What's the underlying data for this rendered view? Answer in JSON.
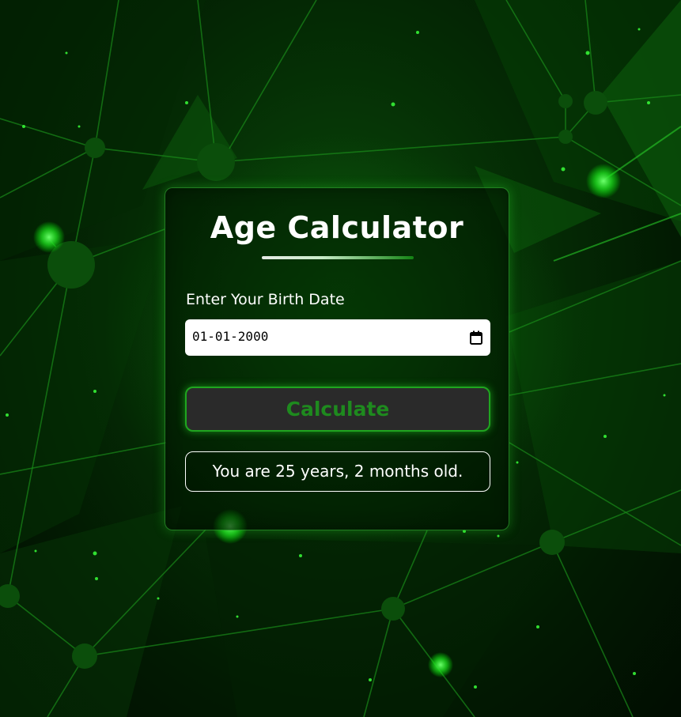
{
  "app": {
    "title": "Age Calculator"
  },
  "form": {
    "label": "Enter Your Birth Date",
    "date_value": "01-01-2000",
    "calendar_icon": "calendar-icon"
  },
  "actions": {
    "calculate_label": "Calculate"
  },
  "result": {
    "text": "You are 25 years, 2 months old."
  },
  "colors": {
    "accent": "#1fa51f",
    "button_text": "#1e8a1e",
    "button_bg": "#2a2a2a",
    "background": "#021a02",
    "text": "#ffffff"
  }
}
